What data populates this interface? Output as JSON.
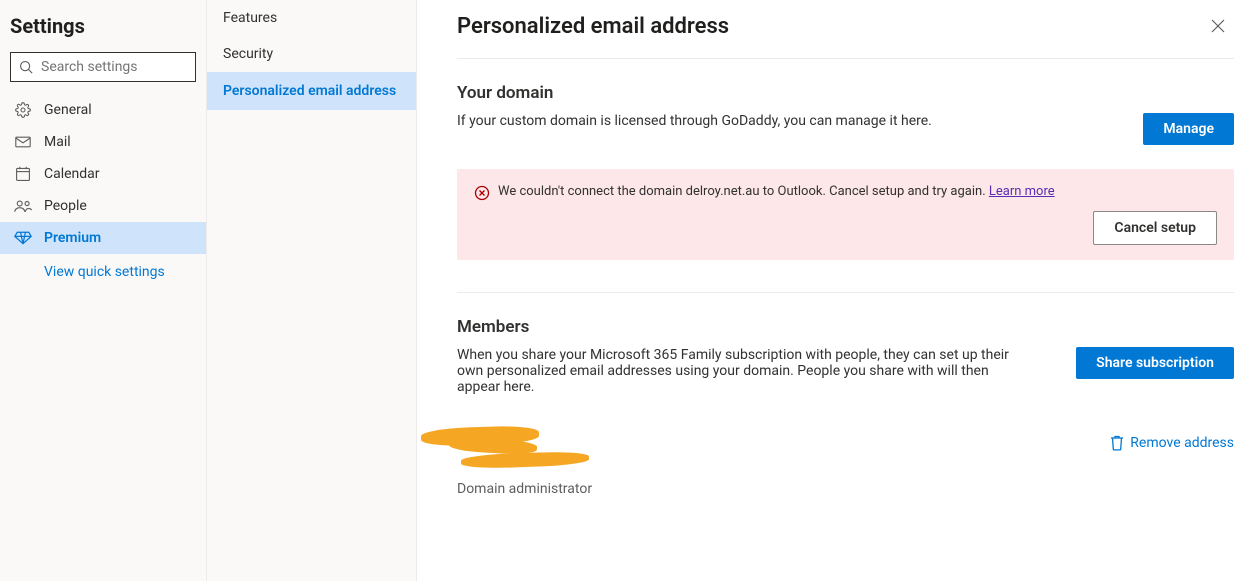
{
  "header": {
    "title": "Settings"
  },
  "search": {
    "placeholder": "Search settings"
  },
  "leftNav": {
    "items": [
      {
        "label": "General",
        "icon": "gear-icon",
        "active": false
      },
      {
        "label": "Mail",
        "icon": "mail-icon",
        "active": false
      },
      {
        "label": "Calendar",
        "icon": "calendar-icon",
        "active": false
      },
      {
        "label": "People",
        "icon": "people-icon",
        "active": false
      },
      {
        "label": "Premium",
        "icon": "diamond-icon",
        "active": true
      }
    ],
    "quickLink": "View quick settings"
  },
  "midNav": {
    "items": [
      {
        "label": "Features",
        "active": false
      },
      {
        "label": "Security",
        "active": false
      },
      {
        "label": "Personalized email address",
        "active": true
      }
    ]
  },
  "main": {
    "title": "Personalized email address",
    "domain": {
      "title": "Your domain",
      "desc": "If your custom domain is licensed through GoDaddy, you can manage it here.",
      "manageLabel": "Manage"
    },
    "error": {
      "text": "We couldn't connect the domain delroy.net.au to Outlook. Cancel setup and try again. ",
      "link": "Learn more",
      "cancelLabel": "Cancel setup"
    },
    "members": {
      "title": "Members",
      "desc": "When you share your Microsoft 365 Family subscription with people, they can set up their own personalized email addresses using your domain. People you share with will then appear here.",
      "shareLabel": "Share subscription",
      "role": "Domain administrator",
      "removeLabel": "Remove address"
    }
  }
}
